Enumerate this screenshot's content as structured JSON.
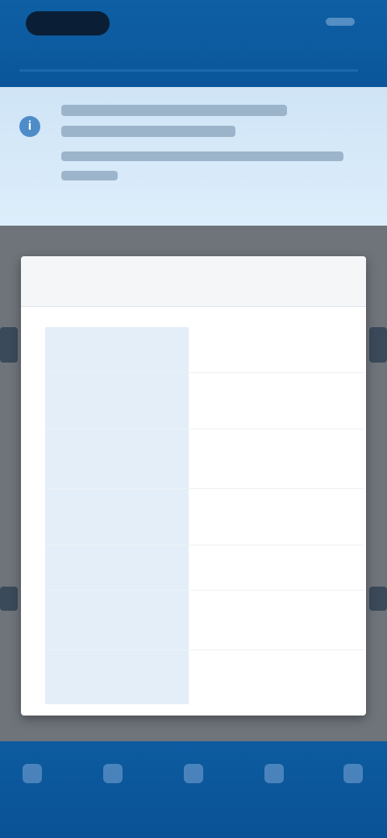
{
  "banner": {
    "info_icon": "i"
  },
  "modal": {
    "title": "",
    "rows": [
      {
        "label": "",
        "value": ""
      },
      {
        "label": "",
        "value": ""
      },
      {
        "label": "",
        "value": ""
      },
      {
        "label": "",
        "value": ""
      },
      {
        "label": "",
        "value": ""
      },
      {
        "label": "",
        "value": ""
      },
      {
        "label": "",
        "value": ""
      }
    ]
  },
  "bottom_nav": {
    "items": [
      {
        "icon": "home-icon",
        "label": ""
      },
      {
        "icon": "list-icon",
        "label": ""
      },
      {
        "icon": "search-icon",
        "label": ""
      },
      {
        "icon": "bell-icon",
        "label": ""
      },
      {
        "icon": "menu-icon",
        "label": ""
      }
    ]
  }
}
